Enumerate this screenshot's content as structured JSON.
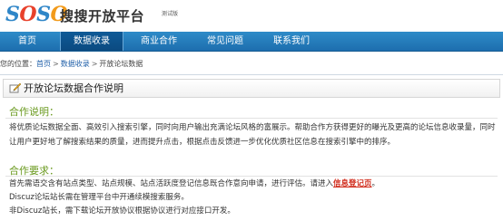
{
  "logo": {
    "s1": "S",
    "o1": "O",
    "s2": "S",
    "o2": "O"
  },
  "brand": "搜搜开放平台",
  "beta": "测试版",
  "nav": {
    "items": [
      {
        "label": "首页"
      },
      {
        "label": "数据收录"
      },
      {
        "label": "商业合作"
      },
      {
        "label": "常见问题"
      },
      {
        "label": "联系我们"
      }
    ]
  },
  "breadcrumb": {
    "prefix": "您的位置：",
    "home": "首页",
    "sep": ">",
    "data": "数据收录",
    "current": "开放论坛数据"
  },
  "page_title": "开放论坛数据合作说明",
  "section1": {
    "title": "合作说明：",
    "text": "将优质论坛数据全面、高效引入搜索引擎，同时向用户输出充满论坛风格的富展示。帮助合作方获得更好的曝光及更高的论坛信息收录量，同时让用户更好地了解搜索结果的质量，进而提升点击，根据点击反馈进一步优化优质社区信息在搜索引擎中的排序。"
  },
  "section2": {
    "title": "合作要求：",
    "line1_text": "首先需语交含有站点类型、站点规模、站点活跃度登记信息既合作意向申请，进行评估。请进入",
    "line1_link": "信息登记页",
    "line1_end": "。",
    "line2": "Discuz论坛站长需在管理平台中开通续模搜索服务。",
    "line3": "非Discuz站长，需下载论坛开放协议根据协议进行对应接口开发。"
  }
}
